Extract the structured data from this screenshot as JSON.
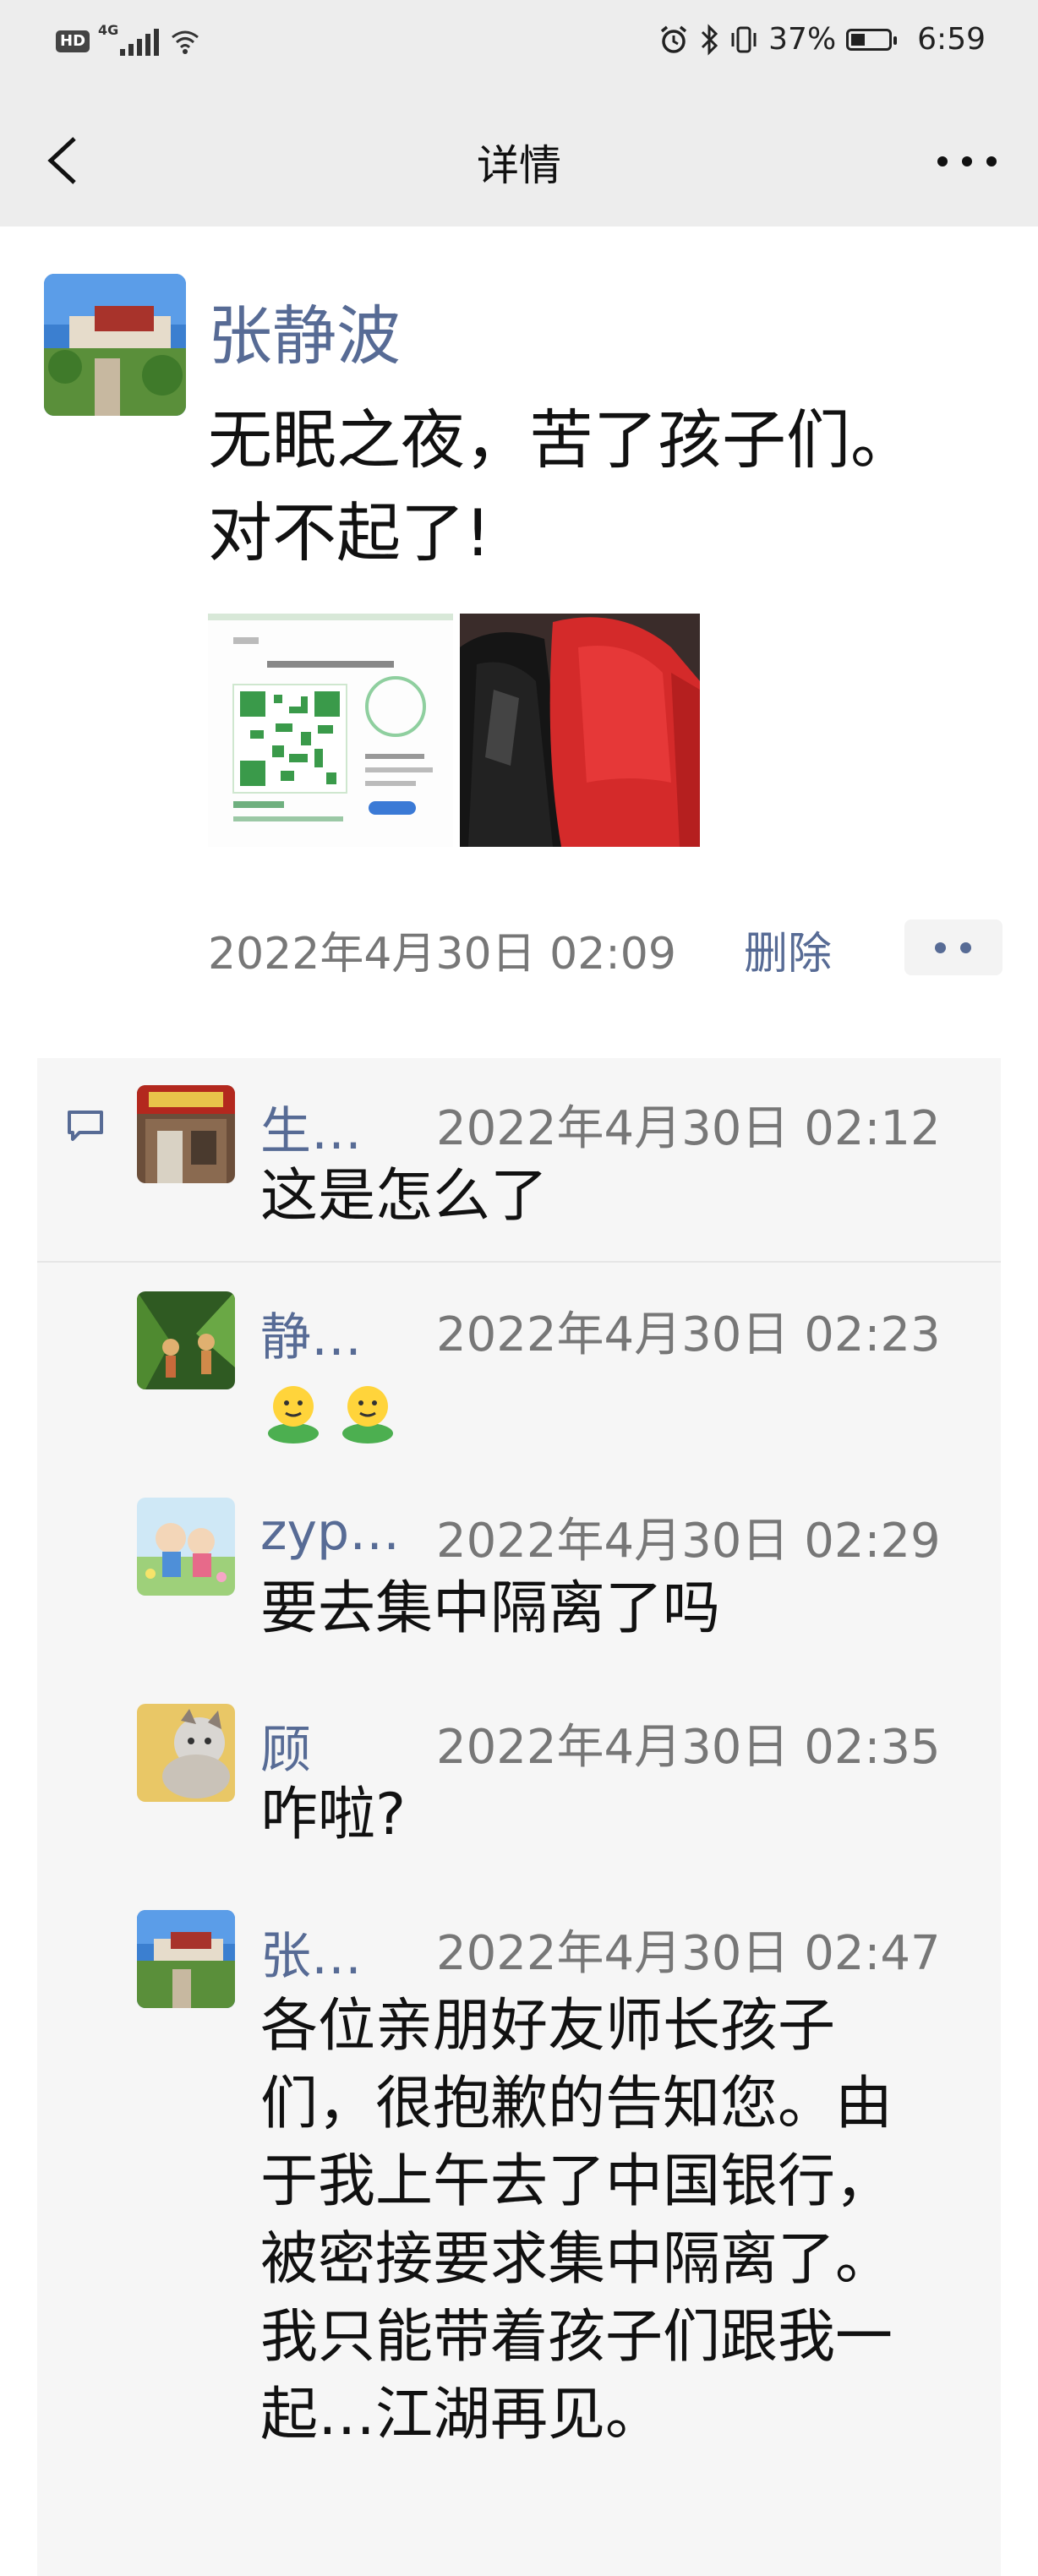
{
  "status_bar": {
    "left_badge": "HD",
    "network": "4G",
    "battery": "37%",
    "battery_level": 0.37,
    "time": "6:59"
  },
  "nav": {
    "title": "详情"
  },
  "post": {
    "author": "张静波",
    "text_line1": "无眠之夜，苦了孩子们。",
    "text_line2": "对不起了!",
    "time": "2022年4月30日 02:09",
    "delete_label": "删除"
  },
  "comments": [
    {
      "name": "生…",
      "time": "2022年4月30日 02:12",
      "text": "这是怎么了"
    },
    {
      "name": "静…",
      "time": "2022年4月30日 02:23",
      "text": ""
    },
    {
      "name": "zyp…",
      "time": "2022年4月30日 02:29",
      "text": "要去集中隔离了吗"
    },
    {
      "name": "顾",
      "time": "2022年4月30日 02:35",
      "text": "咋啦?"
    },
    {
      "name": "张…",
      "time": "2022年4月30日 02:47",
      "text_lines": [
        "各位亲朋好友师长孩子",
        "们，很抱歉的告知您。由",
        "于我上午去了中国银行，",
        "被密接要求集中隔离了。",
        "我只能带着孩子们跟我一",
        "起…江湖再见。"
      ]
    }
  ],
  "colors": {
    "link": "#576b95",
    "bar_bg": "#ededed",
    "panel_bg": "#f6f6f6"
  },
  "icons": [
    "back-arrow-icon",
    "more-dots-icon",
    "comment-bubble-icon",
    "more-dots-icon",
    "bluetooth-icon",
    "vibrate-icon",
    "alarm-icon",
    "wifi-icon",
    "signal-icon",
    "battery-icon",
    "smiling-face-emoji"
  ]
}
